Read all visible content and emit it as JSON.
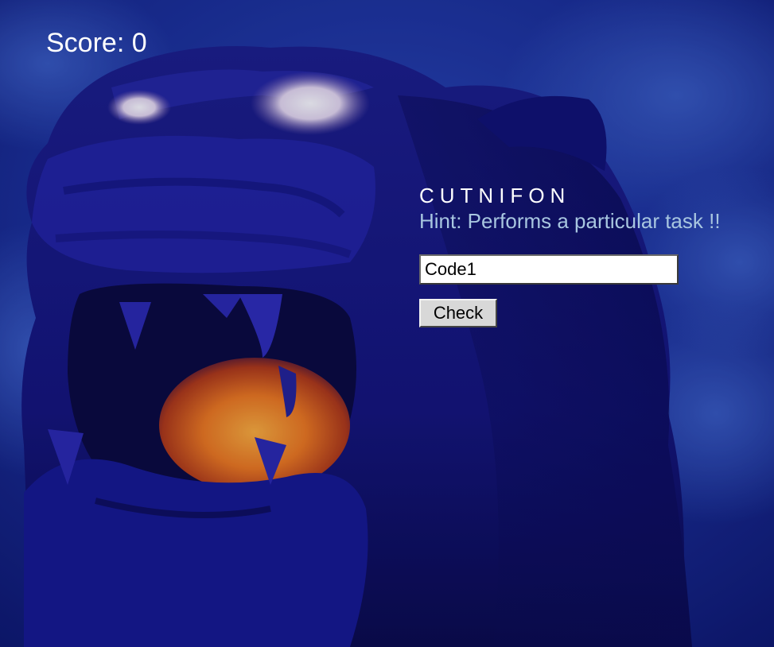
{
  "score": {
    "text": "Score: 0"
  },
  "puzzle": {
    "scrambled_word": "CUTNIFON",
    "hint": "Hint: Performs a particular task !!"
  },
  "answer_input": {
    "value": "Code1"
  },
  "check_button": {
    "label": "Check"
  },
  "colors": {
    "background": "#0a0f5a",
    "score_text": "#ffffff",
    "word_text": "#ffffff",
    "hint_text": "#a8c6e0",
    "mouth_glow": "#f08a1c",
    "eye_glow": "#e8dcf0"
  }
}
